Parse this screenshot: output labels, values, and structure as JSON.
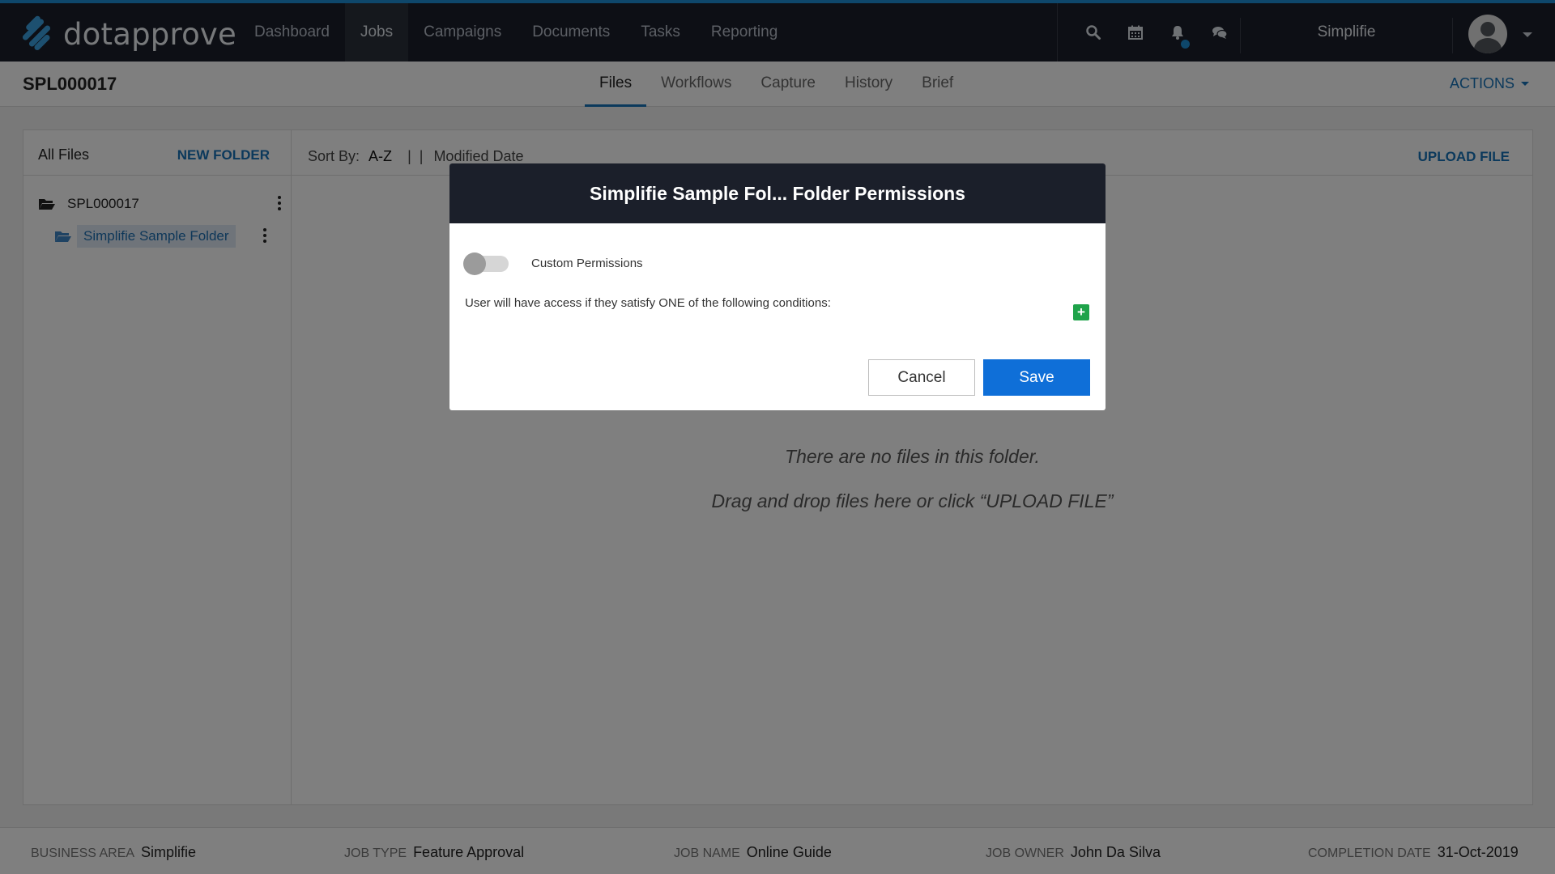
{
  "app": {
    "logo_text": "dotapprove",
    "org_name": "Simplifie"
  },
  "nav": {
    "items": [
      {
        "label": "Dashboard"
      },
      {
        "label": "Jobs",
        "active": true
      },
      {
        "label": "Campaigns"
      },
      {
        "label": "Documents"
      },
      {
        "label": "Tasks"
      },
      {
        "label": "Reporting"
      }
    ]
  },
  "top_icons": [
    "search-icon",
    "calendar-icon",
    "bell-icon",
    "chat-icon"
  ],
  "job": {
    "code": "SPL000017"
  },
  "tabs": [
    {
      "label": "Files",
      "active": true
    },
    {
      "label": "Workflows"
    },
    {
      "label": "Capture"
    },
    {
      "label": "History"
    },
    {
      "label": "Brief"
    }
  ],
  "actions_label": "ACTIONS",
  "left_panel": {
    "title": "All Files",
    "new_folder": "NEW FOLDER",
    "tree": [
      {
        "label": "SPL000017",
        "level": 0
      },
      {
        "label": "Simplifie Sample Folder",
        "level": 1,
        "selected": true
      }
    ]
  },
  "main_panel": {
    "sort_label": "Sort By:",
    "sort_az": "A-Z",
    "sort_sep": "|  |",
    "sort_modified": "Modified Date",
    "upload": "UPLOAD FILE",
    "empty_line1": "There are no files in this folder.",
    "empty_line2": "Drag and drop files here or click “UPLOAD FILE”"
  },
  "footer": {
    "business_area_label": "BUSINESS AREA",
    "business_area": "Simplifie",
    "job_type_label": "JOB TYPE",
    "job_type": "Feature Approval",
    "job_name_label": "JOB NAME",
    "job_name": "Online Guide",
    "job_owner_label": "JOB OWNER",
    "job_owner": "John Da Silva",
    "completion_label": "COMPLETION DATE",
    "completion_date": "31-Oct-2019"
  },
  "modal": {
    "title": "Simplifie Sample Fol... Folder Permissions",
    "toggle_label": "Custom Permissions",
    "toggle_on": false,
    "condition_text": "User will have access if they satisfy ONE of the following conditions:",
    "add_symbol": "+",
    "cancel": "Cancel",
    "save": "Save"
  },
  "colors": {
    "accent": "#1672b8",
    "topbar": "#1b1f2a",
    "save": "#0f6fd8",
    "add": "#1fa34a"
  }
}
